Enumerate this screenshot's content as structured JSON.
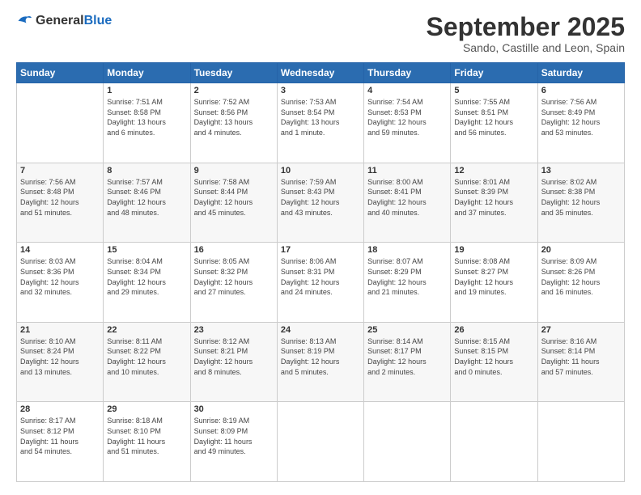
{
  "header": {
    "logo_general": "General",
    "logo_blue": "Blue",
    "month_title": "September 2025",
    "subtitle": "Sando, Castille and Leon, Spain"
  },
  "days_of_week": [
    "Sunday",
    "Monday",
    "Tuesday",
    "Wednesday",
    "Thursday",
    "Friday",
    "Saturday"
  ],
  "weeks": [
    [
      {
        "day": "",
        "content": ""
      },
      {
        "day": "1",
        "content": "Sunrise: 7:51 AM\nSunset: 8:58 PM\nDaylight: 13 hours\nand 6 minutes."
      },
      {
        "day": "2",
        "content": "Sunrise: 7:52 AM\nSunset: 8:56 PM\nDaylight: 13 hours\nand 4 minutes."
      },
      {
        "day": "3",
        "content": "Sunrise: 7:53 AM\nSunset: 8:54 PM\nDaylight: 13 hours\nand 1 minute."
      },
      {
        "day": "4",
        "content": "Sunrise: 7:54 AM\nSunset: 8:53 PM\nDaylight: 12 hours\nand 59 minutes."
      },
      {
        "day": "5",
        "content": "Sunrise: 7:55 AM\nSunset: 8:51 PM\nDaylight: 12 hours\nand 56 minutes."
      },
      {
        "day": "6",
        "content": "Sunrise: 7:56 AM\nSunset: 8:49 PM\nDaylight: 12 hours\nand 53 minutes."
      }
    ],
    [
      {
        "day": "7",
        "content": "Sunrise: 7:56 AM\nSunset: 8:48 PM\nDaylight: 12 hours\nand 51 minutes."
      },
      {
        "day": "8",
        "content": "Sunrise: 7:57 AM\nSunset: 8:46 PM\nDaylight: 12 hours\nand 48 minutes."
      },
      {
        "day": "9",
        "content": "Sunrise: 7:58 AM\nSunset: 8:44 PM\nDaylight: 12 hours\nand 45 minutes."
      },
      {
        "day": "10",
        "content": "Sunrise: 7:59 AM\nSunset: 8:43 PM\nDaylight: 12 hours\nand 43 minutes."
      },
      {
        "day": "11",
        "content": "Sunrise: 8:00 AM\nSunset: 8:41 PM\nDaylight: 12 hours\nand 40 minutes."
      },
      {
        "day": "12",
        "content": "Sunrise: 8:01 AM\nSunset: 8:39 PM\nDaylight: 12 hours\nand 37 minutes."
      },
      {
        "day": "13",
        "content": "Sunrise: 8:02 AM\nSunset: 8:38 PM\nDaylight: 12 hours\nand 35 minutes."
      }
    ],
    [
      {
        "day": "14",
        "content": "Sunrise: 8:03 AM\nSunset: 8:36 PM\nDaylight: 12 hours\nand 32 minutes."
      },
      {
        "day": "15",
        "content": "Sunrise: 8:04 AM\nSunset: 8:34 PM\nDaylight: 12 hours\nand 29 minutes."
      },
      {
        "day": "16",
        "content": "Sunrise: 8:05 AM\nSunset: 8:32 PM\nDaylight: 12 hours\nand 27 minutes."
      },
      {
        "day": "17",
        "content": "Sunrise: 8:06 AM\nSunset: 8:31 PM\nDaylight: 12 hours\nand 24 minutes."
      },
      {
        "day": "18",
        "content": "Sunrise: 8:07 AM\nSunset: 8:29 PM\nDaylight: 12 hours\nand 21 minutes."
      },
      {
        "day": "19",
        "content": "Sunrise: 8:08 AM\nSunset: 8:27 PM\nDaylight: 12 hours\nand 19 minutes."
      },
      {
        "day": "20",
        "content": "Sunrise: 8:09 AM\nSunset: 8:26 PM\nDaylight: 12 hours\nand 16 minutes."
      }
    ],
    [
      {
        "day": "21",
        "content": "Sunrise: 8:10 AM\nSunset: 8:24 PM\nDaylight: 12 hours\nand 13 minutes."
      },
      {
        "day": "22",
        "content": "Sunrise: 8:11 AM\nSunset: 8:22 PM\nDaylight: 12 hours\nand 10 minutes."
      },
      {
        "day": "23",
        "content": "Sunrise: 8:12 AM\nSunset: 8:21 PM\nDaylight: 12 hours\nand 8 minutes."
      },
      {
        "day": "24",
        "content": "Sunrise: 8:13 AM\nSunset: 8:19 PM\nDaylight: 12 hours\nand 5 minutes."
      },
      {
        "day": "25",
        "content": "Sunrise: 8:14 AM\nSunset: 8:17 PM\nDaylight: 12 hours\nand 2 minutes."
      },
      {
        "day": "26",
        "content": "Sunrise: 8:15 AM\nSunset: 8:15 PM\nDaylight: 12 hours\nand 0 minutes."
      },
      {
        "day": "27",
        "content": "Sunrise: 8:16 AM\nSunset: 8:14 PM\nDaylight: 11 hours\nand 57 minutes."
      }
    ],
    [
      {
        "day": "28",
        "content": "Sunrise: 8:17 AM\nSunset: 8:12 PM\nDaylight: 11 hours\nand 54 minutes."
      },
      {
        "day": "29",
        "content": "Sunrise: 8:18 AM\nSunset: 8:10 PM\nDaylight: 11 hours\nand 51 minutes."
      },
      {
        "day": "30",
        "content": "Sunrise: 8:19 AM\nSunset: 8:09 PM\nDaylight: 11 hours\nand 49 minutes."
      },
      {
        "day": "",
        "content": ""
      },
      {
        "day": "",
        "content": ""
      },
      {
        "day": "",
        "content": ""
      },
      {
        "day": "",
        "content": ""
      }
    ]
  ]
}
